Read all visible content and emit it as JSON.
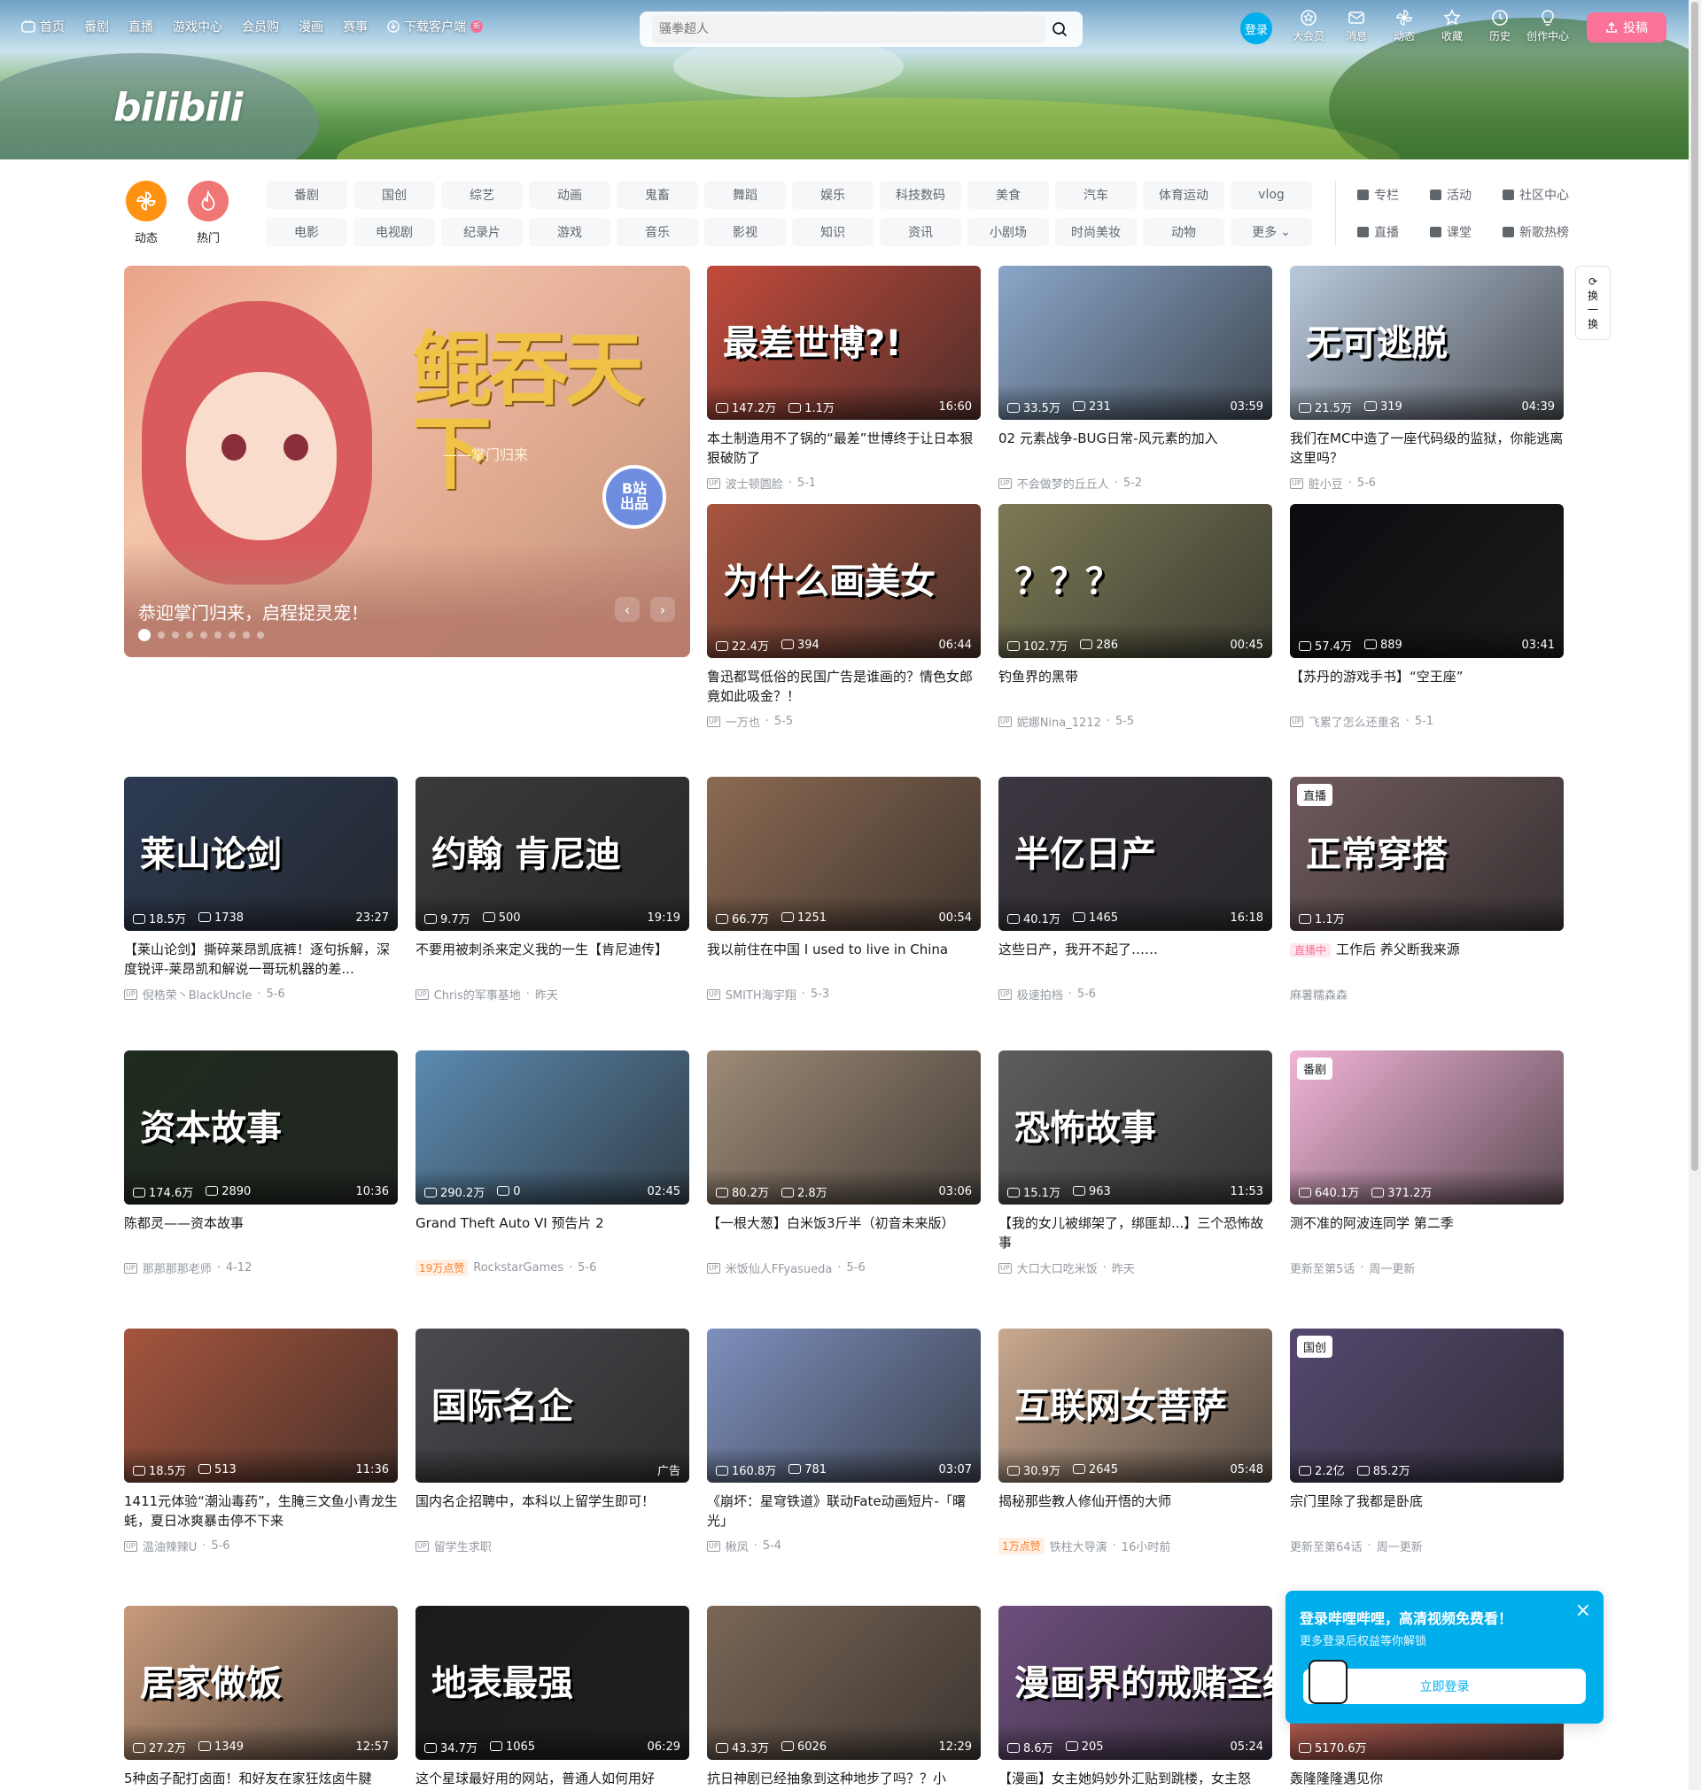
{
  "header": {
    "nav": [
      "首页",
      "番剧",
      "直播",
      "游戏中心",
      "会员购",
      "漫画",
      "赛事",
      "下载客户端"
    ],
    "new_badge": "新",
    "logo": "bilibili",
    "search_placeholder": "骚拳超人",
    "login": "登录",
    "right": [
      "大会员",
      "消息",
      "动态",
      "收藏",
      "历史",
      "创作中心"
    ],
    "upload": "投稿",
    "accent": "#fb7299",
    "blue": "#00aeec"
  },
  "channels": {
    "circles": [
      {
        "label": "动态",
        "color": "#ff9212",
        "icon": "pinwheel-icon"
      },
      {
        "label": "热门",
        "color": "#f07775",
        "icon": "flame-icon"
      }
    ],
    "chips": [
      "番剧",
      "国创",
      "综艺",
      "动画",
      "鬼畜",
      "舞蹈",
      "娱乐",
      "科技数码",
      "美食",
      "汽车",
      "体育运动",
      "vlog",
      "电影",
      "电视剧",
      "纪录片",
      "游戏",
      "音乐",
      "影视",
      "知识",
      "资讯",
      "小剧场",
      "时尚美妆",
      "动物",
      "更多"
    ],
    "links": [
      "专栏",
      "活动",
      "社区中心",
      "直播",
      "课堂",
      "新歌热榜"
    ]
  },
  "carousel": {
    "title_art": "鲲吞天下",
    "subtitle_art": "——掌门归来",
    "badge_line1": "B站",
    "badge_line2": "出品",
    "caption": "恭迎掌门归来，启程捉灵宠！",
    "prev": "‹",
    "next": "›"
  },
  "refresh": {
    "label1": "换",
    "label2": "一",
    "label3": "换"
  },
  "cards": [
    {
      "title": "本土制造用不了锅的“最差”世博终于让日本狠狠破防了",
      "views": "147.2万",
      "danmaku": "1.1万",
      "duration": "16:60",
      "author": "波士顿圆脸",
      "date": "5-1",
      "overlay": "最差世博?!",
      "bg": "#c24b3c"
    },
    {
      "title": "02 元素战争-BUG日常-风元素的加入",
      "views": "33.5万",
      "danmaku": "231",
      "duration": "03:59",
      "author": "不会做梦的丘丘人",
      "date": "5-2",
      "overlay": "",
      "bg": "#8aa6c9"
    },
    {
      "title": "我们在MC中造了一座代码级的监狱，你能逃离这里吗？",
      "views": "21.5万",
      "danmaku": "319",
      "duration": "04:39",
      "author": "脏小豆",
      "date": "5-6",
      "overlay": "无可逃脱",
      "bg": "#b9c9dd"
    },
    {
      "title": "鲁迅都骂低俗的民国广告是谁画的？情色女郎竟如此吸金？！",
      "views": "22.4万",
      "danmaku": "394",
      "duration": "06:44",
      "author": "一万也",
      "date": "5-5",
      "overlay": "为什么画美女",
      "bg": "#a8553f"
    },
    {
      "title": "钓鱼界的黑带",
      "views": "102.7万",
      "danmaku": "286",
      "duration": "00:45",
      "author": "妮娜Nina_1212",
      "date": "5-5",
      "overlay": "？？？",
      "bg": "#7d7a55"
    },
    {
      "title": "【苏丹的游戏手书】“空王座”",
      "views": "57.4万",
      "danmaku": "889",
      "duration": "03:41",
      "author": "飞累了怎么还重名",
      "date": "5-1",
      "overlay": "",
      "bg": "#0c0c10"
    },
    {
      "title": "【莱山论剑】撕碎莱昂凯底裤！逐句拆解，深度锐评-莱昂凯和解说一哥玩机器的差...",
      "views": "18.5万",
      "danmaku": "1738",
      "duration": "23:27",
      "author": "倪梏荣丶BlackUncle",
      "date": "5-6",
      "overlay": "莱山论剑",
      "bg": "#2c3a52"
    },
    {
      "title": "不要用被刺杀来定义我的一生【肯尼迪传】",
      "views": "9.7万",
      "danmaku": "500",
      "duration": "19:19",
      "author": "Chris的军事基地",
      "date": "昨天",
      "overlay": "约翰 肯尼迪",
      "bg": "#3a3a3a"
    },
    {
      "title": "我以前住在中国 I used to live in China",
      "views": "66.7万",
      "danmaku": "1251",
      "duration": "00:54",
      "author": "SMITH海宇翔",
      "date": "5-3",
      "overlay": "",
      "bg": "#8c6a52"
    },
    {
      "title": "这些日产，我开不起了……",
      "views": "40.1万",
      "danmaku": "1465",
      "duration": "16:18",
      "author": "极速拍档",
      "date": "5-6",
      "overlay": "半亿日产",
      "bg": "#3c3640"
    },
    {
      "title": "工作后 养父断我来源",
      "views": "1.1万",
      "danmaku": "",
      "duration": "",
      "author": "麻薯糯森森",
      "date": "",
      "overlay": "正常穿搭",
      "bg": "#6f5a5c",
      "tag": "直播",
      "live": "直播中"
    },
    {
      "title": "陈都灵——资本故事",
      "views": "174.6万",
      "danmaku": "2890",
      "duration": "10:36",
      "author": "那那那那老师",
      "date": "4-12",
      "overlay": "资本故事",
      "bg": "#1f2b1e"
    },
    {
      "title": "Grand Theft Auto VI 预告片 2",
      "views": "290.2万",
      "danmaku": "0",
      "duration": "02:45",
      "author": "RockstarGames",
      "date": "5-6",
      "overlay": "",
      "bg": "#5b8ab0",
      "hot": "19万点赞"
    },
    {
      "title": "【一根大葱】白米饭3斤半（初音未来版）",
      "views": "80.2万",
      "danmaku": "2.8万",
      "duration": "03:06",
      "author": "米饭仙人FFyasueda",
      "date": "5-6",
      "overlay": "",
      "bg": "#9e8a76"
    },
    {
      "title": "【我的女儿被绑架了，绑匪却...】三个恐怖故事",
      "views": "15.1万",
      "danmaku": "963",
      "duration": "11:53",
      "author": "大口大口吃米饭",
      "date": "昨天",
      "overlay": "恐怖故事",
      "bg": "#5d5d5d"
    },
    {
      "title": "测不准的阿波连同学 第二季",
      "views": "640.1万",
      "danmaku": "371.2万",
      "duration": "",
      "author": "更新至第5话",
      "date": "周一更新",
      "overlay": "",
      "bg": "#f1b4d6",
      "tag": "番剧"
    },
    {
      "title": "1411元体验“潮汕毒药”，生腌三文鱼小青龙生蚝，夏日冰爽暴击停不下来",
      "views": "18.5万",
      "danmaku": "513",
      "duration": "11:36",
      "author": "温油辣辣U",
      "date": "5-6",
      "overlay": "",
      "bg": "#a5553d"
    },
    {
      "title": "国内名企招聘中，本科以上留学生即可！",
      "views": "",
      "danmaku": "",
      "duration": "广告",
      "author": "留学生求职",
      "date": "",
      "overlay": "国际名企",
      "bg": "#4a4a4f"
    },
    {
      "title": "《崩坏：星穹铁道》联动Fate动画短片-「曙光」",
      "views": "160.8万",
      "danmaku": "781",
      "duration": "03:07",
      "author": "楸凤",
      "date": "5-4",
      "overlay": "",
      "bg": "#7d8fbd"
    },
    {
      "title": "揭秘那些教人修仙开悟的大师",
      "views": "30.9万",
      "danmaku": "2645",
      "duration": "05:48",
      "author": "铁柱大导演",
      "date": "16小时前",
      "overlay": "互联网女菩萨",
      "bg": "#caa98f",
      "hot": "1万点赞"
    },
    {
      "title": "宗门里除了我都是卧底",
      "views": "2.2亿",
      "danmaku": "85.2万",
      "duration": "",
      "author": "更新至第64话",
      "date": "周一更新",
      "overlay": "",
      "bg": "#55486f",
      "tag": "国创"
    },
    {
      "title": "5种卤子配打卤面！和好友在家狂炫卤牛腱",
      "views": "27.2万",
      "danmaku": "1349",
      "duration": "12:57",
      "author": "",
      "date": "",
      "overlay": "居家做饭",
      "bg": "#c79a7a"
    },
    {
      "title": "这个星球最好用的网站，普通人如何用好",
      "views": "34.7万",
      "danmaku": "1065",
      "duration": "06:29",
      "author": "",
      "date": "",
      "overlay": "地表最强",
      "bg": "#1b1b1e"
    },
    {
      "title": "抗日神剧已经抽象到这种地步了吗？？小",
      "views": "43.3万",
      "danmaku": "6026",
      "duration": "12:29",
      "author": "",
      "date": "",
      "overlay": "",
      "bg": "#7a6656"
    },
    {
      "title": "【漫画】女主她妈妙外汇贴到跳楼，女主怒",
      "views": "8.6万",
      "danmaku": "205",
      "duration": "05:24",
      "author": "",
      "date": "",
      "overlay": "漫画界的戒赌圣经",
      "bg": "#6d4e7d"
    },
    {
      "title": "轰隆隆隆遇见你",
      "views": "5170.6万",
      "danmaku": "",
      "duration": "",
      "author": "",
      "date": "",
      "overlay": "",
      "bg": "#d96b5c"
    }
  ],
  "popup": {
    "title": "登录哔哩哔哩，高清视频免费看！",
    "desc": "更多登录后权益等你解锁",
    "button": "立即登录",
    "close": "×"
  }
}
